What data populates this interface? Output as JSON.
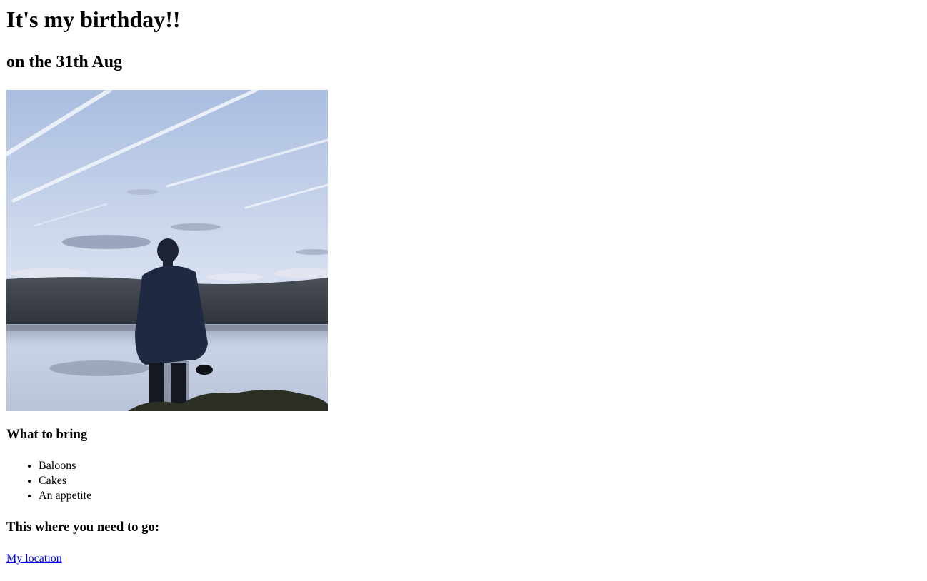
{
  "header": {
    "title": "It's my birthday!!",
    "date": "on the 31th Aug"
  },
  "photo": {
    "subject": "person-at-lake-photo",
    "colors": {
      "sky_top": "#a9bde0",
      "sky_bottom": "#e2e9f4",
      "hills": "#3a3f49",
      "water": "#c6d0e4",
      "figure": "#1c2436"
    }
  },
  "bring": {
    "heading": "What to bring",
    "items": [
      {
        "label": "Baloons"
      },
      {
        "label": "Cakes"
      },
      {
        "label": "An appetite"
      }
    ]
  },
  "location": {
    "heading": "This where you need to go:",
    "link_label": "My location",
    "link_color": "#0000ee"
  }
}
